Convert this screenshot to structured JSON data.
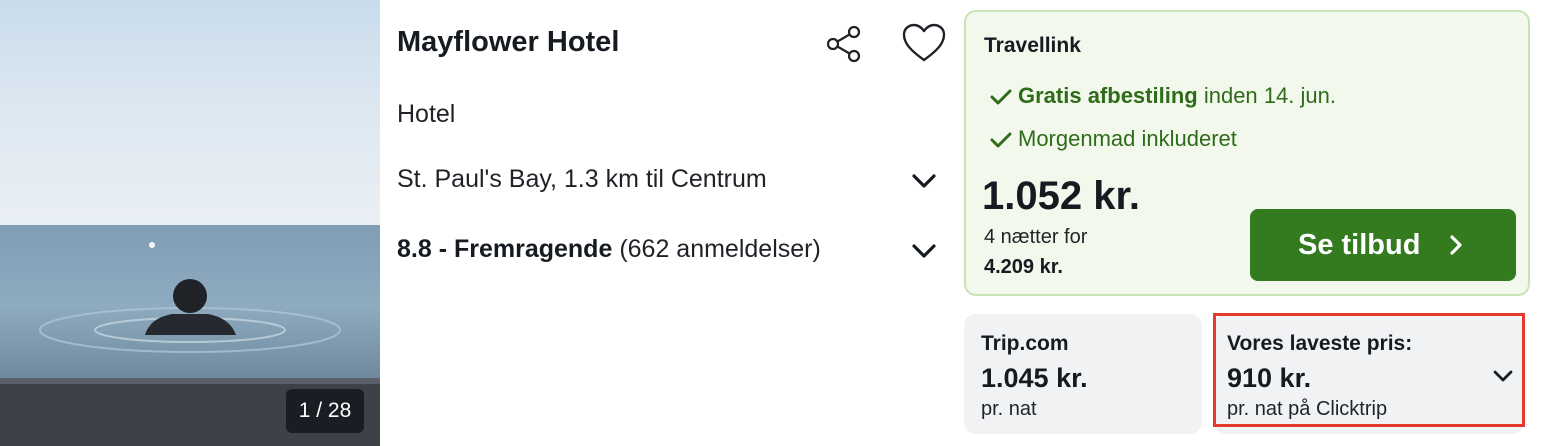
{
  "hotel": {
    "name": "Mayflower Hotel",
    "type": "Hotel",
    "location": "St. Paul's Bay, 1.3 km til Centrum",
    "rating_score": "8.8 - Fremragende",
    "rating_reviews": "(662 anmeldelser)"
  },
  "gallery": {
    "counter": "1 / 28"
  },
  "main_offer": {
    "provider": "Travellink",
    "cancellation_bold": "Gratis afbestiling",
    "cancellation_rest": " inden 14. jun.",
    "breakfast": "Morgenmad inkluderet",
    "price": "1.052 kr.",
    "nights_label": "4 nætter for",
    "total": "4.209 kr.",
    "cta_label": "Se tilbud"
  },
  "alt_offers": [
    {
      "provider": "Trip.com",
      "price": "1.045 kr.",
      "sub": "pr. nat"
    },
    {
      "provider": "Vores laveste pris:",
      "price": "910 kr.",
      "sub": "pr. nat på Clicktrip"
    }
  ],
  "icons": {
    "share": "share-icon",
    "favorite": "heart-icon",
    "expand": "chevron-down-icon",
    "check": "check-icon",
    "arrow": "chevron-right-icon"
  },
  "colors": {
    "accent_green": "#347a1f",
    "feature_green": "#2f6b1a",
    "offer_bg": "#f2f9ec",
    "highlight_red": "#e23a2c"
  }
}
